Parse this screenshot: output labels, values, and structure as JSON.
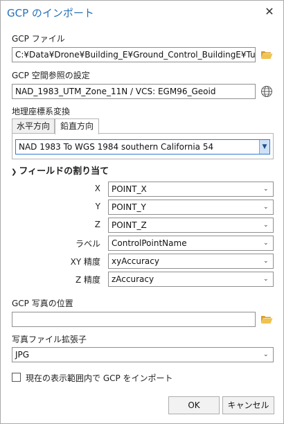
{
  "dialog": {
    "title": "GCP のインポート",
    "close_label": "✕"
  },
  "gcp_file": {
    "label": "GCP ファイル",
    "value": "C:¥Data¥Drone¥Building_E¥Ground_Control_BuildingE¥Tut_Groun"
  },
  "spatial_ref": {
    "label": "GCP 空間参照の設定",
    "value": "NAD_1983_UTM_Zone_11N / VCS: EGM96_Geoid"
  },
  "transform": {
    "label": "地理座標系変換",
    "tabs": [
      {
        "label": "水平方向"
      },
      {
        "label": "鉛直方向"
      }
    ],
    "active_tab": "鉛直方向",
    "selected": "NAD 1983 To WGS 1984 southern California 54"
  },
  "field_mapping": {
    "title": "フィールドの割り当て",
    "rows": [
      {
        "label": "X",
        "value": "POINT_X"
      },
      {
        "label": "Y",
        "value": "POINT_Y"
      },
      {
        "label": "Z",
        "value": "POINT_Z"
      },
      {
        "label": "ラベル",
        "value": "ControlPointName"
      },
      {
        "label": "XY 精度",
        "value": "xyAccuracy"
      },
      {
        "label": "Z 精度",
        "value": "zAccuracy"
      }
    ]
  },
  "photo_location": {
    "label": "GCP 写真の位置",
    "value": ""
  },
  "photo_ext": {
    "label": "写真ファイル拡張子",
    "value": "JPG"
  },
  "import_extent": {
    "label": "現在の表示範囲内で GCP をインポート",
    "checked": false
  },
  "buttons": {
    "ok": "OK",
    "cancel": "キャンセル"
  },
  "colors": {
    "title": "#2771b8",
    "folder": "#e8b53d",
    "focus": "#2f7bd1"
  }
}
